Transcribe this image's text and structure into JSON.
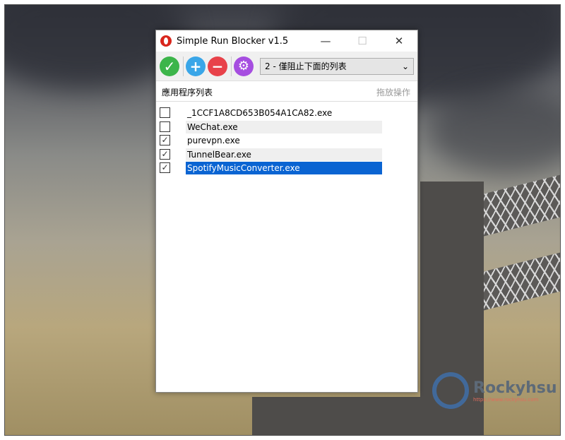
{
  "window": {
    "title": "Simple Run Blocker v1.5",
    "minimize": "—",
    "maximize": "☐",
    "close": "✕"
  },
  "toolbar": {
    "enable_icon": "check-icon",
    "add_icon": "plus-icon",
    "remove_icon": "minus-icon",
    "settings_icon": "gear-icon",
    "mode_value": "2 - 僅阻止下面的列表",
    "dropdown_arrow": "⌄"
  },
  "list": {
    "header_left": "應用程序列表",
    "header_right": "拖放操作",
    "items": [
      {
        "name": "_1CCF1A8CD653B054A1CA82.exe",
        "checked": false
      },
      {
        "name": "WeChat.exe",
        "checked": false
      },
      {
        "name": "purevpn.exe",
        "checked": true
      },
      {
        "name": "TunnelBear.exe",
        "checked": true
      },
      {
        "name": "SpotifyMusicConverter.exe",
        "checked": true,
        "selected": true
      }
    ]
  },
  "watermark": {
    "name": "Rockyhsu",
    "url": "https://www.rockyhsu.com"
  },
  "colors": {
    "selection": "#0a64d2",
    "green": "#3cb54a",
    "blue": "#3aa6e8",
    "red": "#e8424a",
    "purple": "#a64ee0"
  }
}
